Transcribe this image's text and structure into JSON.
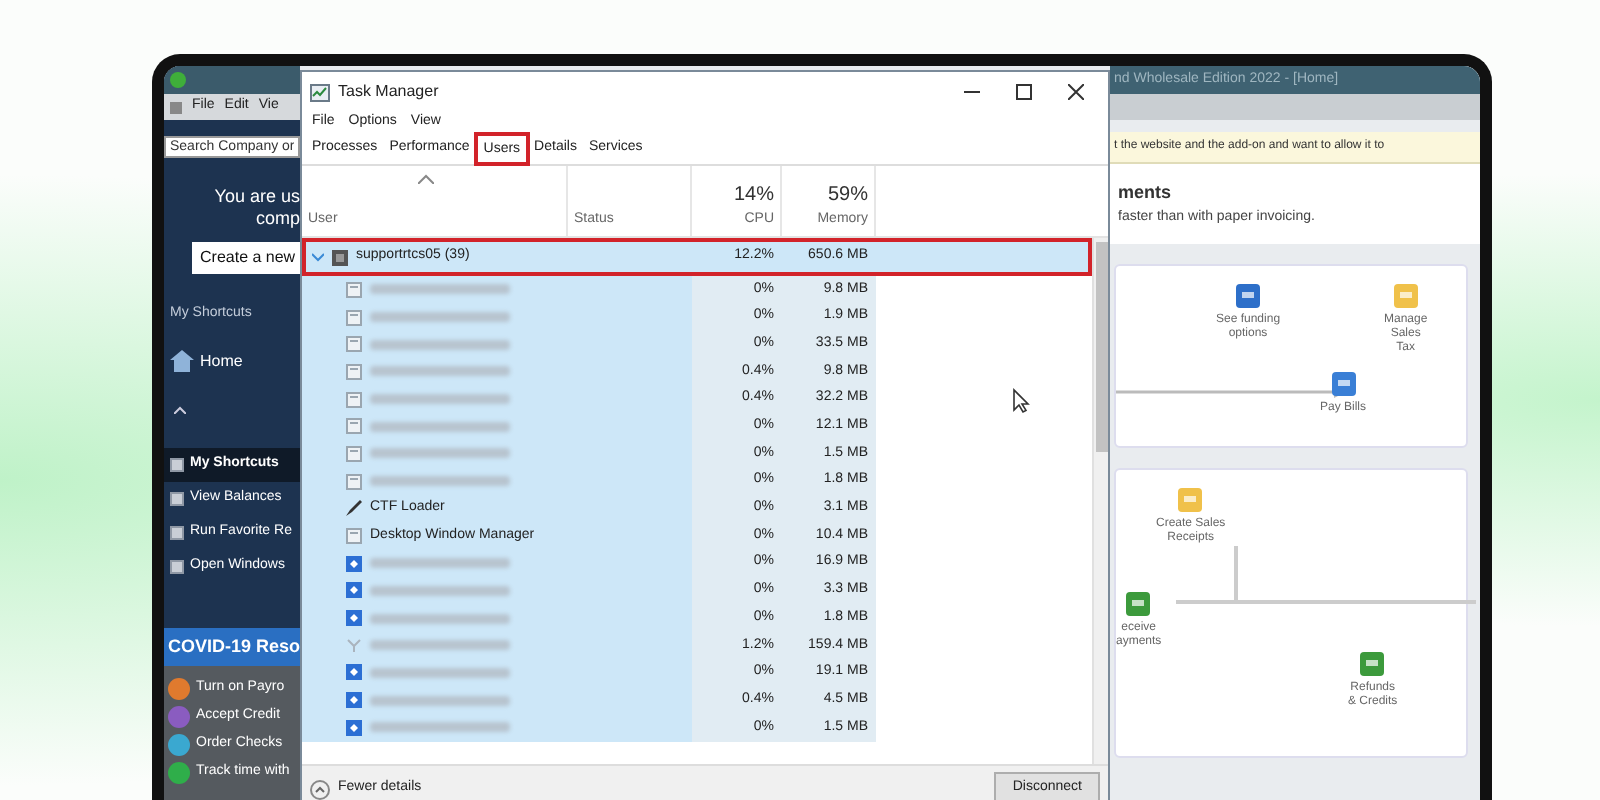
{
  "background_app": {
    "title": "nd Wholesale Edition 2022 - [Home]",
    "menu": [
      "File",
      "Edit",
      "Vie"
    ],
    "search_placeholder": "Search Company or",
    "notice_lines": [
      "You are us",
      "comp"
    ],
    "create_button": "Create a new",
    "shortcuts_heading": "My Shortcuts",
    "home_item": "Home",
    "shortcuts": [
      {
        "label": "My Shortcuts",
        "selected": true
      },
      {
        "label": "View Balances",
        "selected": false
      },
      {
        "label": "Run Favorite Re",
        "selected": false
      },
      {
        "label": "Open Windows",
        "selected": false
      }
    ],
    "covid_heading": "COVID-19 Reso",
    "covid_items": [
      {
        "label": "Turn on Payro",
        "color": "#e07a2e"
      },
      {
        "label": "Accept Credit",
        "color": "#8a5cc0"
      },
      {
        "label": "Order Checks",
        "color": "#3aa8d0"
      },
      {
        "label": "Track time with",
        "color": "#2fae4a"
      }
    ],
    "banner": "t the website and the add-on and want to allow it to",
    "home_heading": "ments",
    "home_subtitle": "faster than with paper invoicing.",
    "flow_cards": [
      {
        "nodes": [
          {
            "kind": "funding",
            "lines": [
              "See funding",
              "options"
            ]
          },
          {
            "kind": "tax",
            "lines": [
              "Manage",
              "Sales",
              "Tax"
            ]
          },
          {
            "kind": "bills",
            "lines": [
              "Pay Bills"
            ]
          }
        ]
      },
      {
        "nodes": [
          {
            "kind": "receipt",
            "lines": [
              "Create Sales",
              "Receipts"
            ]
          },
          {
            "kind": "payments",
            "lines": [
              "eceive",
              "ayments"
            ]
          },
          {
            "kind": "refunds",
            "lines": [
              "Refunds",
              "& Credits"
            ]
          }
        ]
      }
    ]
  },
  "task_manager": {
    "title": "Task Manager",
    "menu": [
      "File",
      "Options",
      "View"
    ],
    "tabs": [
      {
        "label": "Processes",
        "selected": false,
        "annotated": false
      },
      {
        "label": "Performance",
        "selected": false,
        "annotated": false
      },
      {
        "label": "Users",
        "selected": true,
        "annotated": true
      },
      {
        "label": "Details",
        "selected": false,
        "annotated": false
      },
      {
        "label": "Services",
        "selected": false,
        "annotated": false
      }
    ],
    "columns": {
      "user": "User",
      "status": "Status",
      "cpu_total": "14%",
      "cpu": "CPU",
      "memory_total": "59%",
      "memory": "Memory"
    },
    "user": {
      "name": "supportrtcs05 (39)",
      "cpu": "12.2%",
      "memory": "650.6 MB",
      "expanded": true,
      "annotated": true
    },
    "processes": [
      {
        "kind": "app",
        "cpu": "0%",
        "memory": "9.8 MB"
      },
      {
        "kind": "app",
        "cpu": "0%",
        "memory": "1.9 MB"
      },
      {
        "kind": "app",
        "cpu": "0%",
        "memory": "33.5 MB"
      },
      {
        "kind": "app",
        "cpu": "0.4%",
        "memory": "9.8 MB"
      },
      {
        "kind": "app",
        "cpu": "0.4%",
        "memory": "32.2 MB"
      },
      {
        "kind": "app",
        "cpu": "0%",
        "memory": "12.1 MB"
      },
      {
        "kind": "app",
        "cpu": "0%",
        "memory": "1.5 MB"
      },
      {
        "kind": "app",
        "cpu": "0%",
        "memory": "1.8 MB"
      },
      {
        "kind": "pen",
        "name": "CTF Loader",
        "cpu": "0%",
        "memory": "3.1 MB"
      },
      {
        "kind": "app",
        "name": "Desktop Window Manager",
        "cpu": "0%",
        "memory": "10.4 MB"
      },
      {
        "kind": "box",
        "cpu": "0%",
        "memory": "16.9 MB"
      },
      {
        "kind": "box",
        "cpu": "0%",
        "memory": "3.3 MB"
      },
      {
        "kind": "box",
        "cpu": "0%",
        "memory": "1.8 MB"
      },
      {
        "kind": "light",
        "cpu": "1.2%",
        "memory": "159.4 MB"
      },
      {
        "kind": "box",
        "cpu": "0%",
        "memory": "19.1 MB"
      },
      {
        "kind": "box",
        "cpu": "0.4%",
        "memory": "4.5 MB"
      },
      {
        "kind": "box",
        "cpu": "0%",
        "memory": "1.5 MB"
      }
    ],
    "fewer_details": "Fewer details",
    "disconnect_button": "Disconnect"
  }
}
